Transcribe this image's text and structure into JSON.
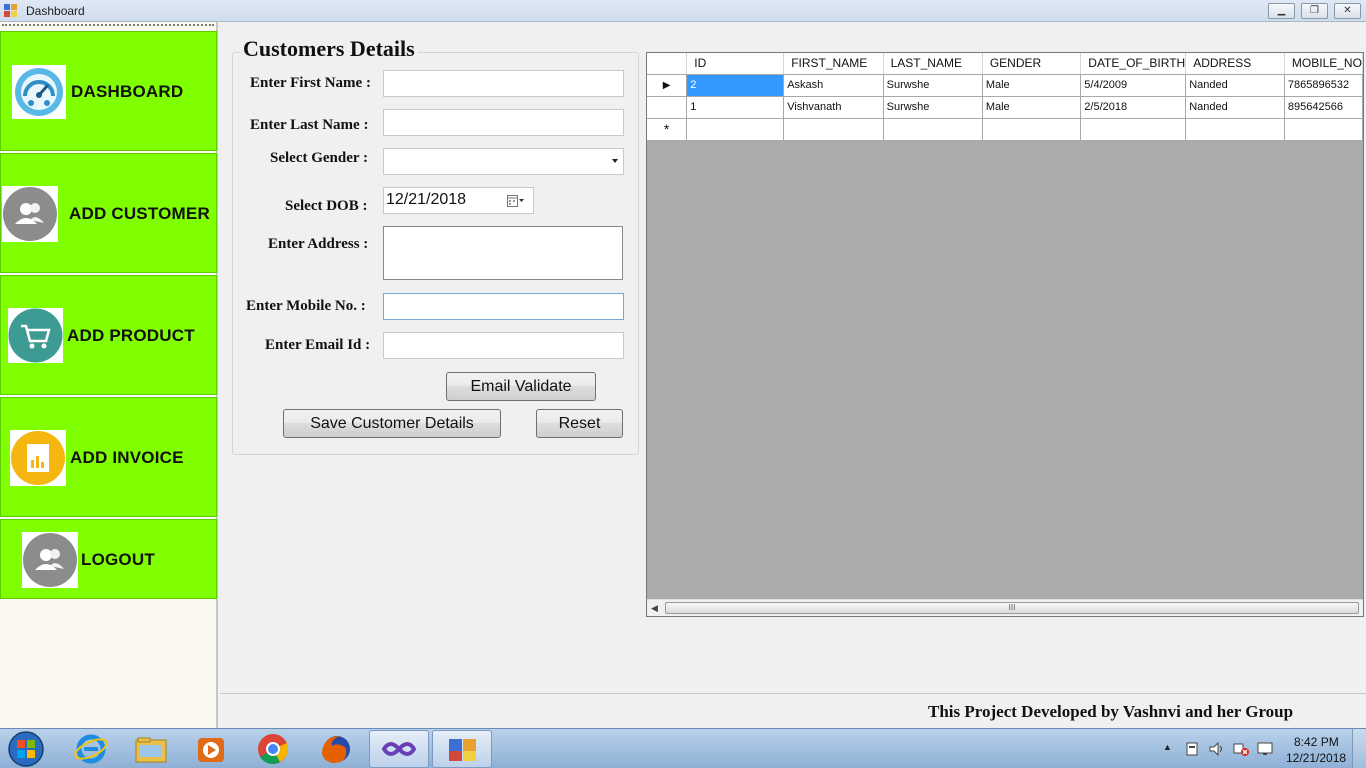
{
  "window": {
    "title": "Dashboard",
    "controls": {
      "minimize": "▁",
      "restore": "❐",
      "close": "✕"
    }
  },
  "sidebar": {
    "items": [
      {
        "label": "DASHBOARD",
        "icon": "speedometer-icon"
      },
      {
        "label": "ADD CUSTOMER",
        "icon": "users-icon"
      },
      {
        "label": "ADD PRODUCT",
        "icon": "cart-icon"
      },
      {
        "label": "ADD INVOICE",
        "icon": "chart-document-icon"
      },
      {
        "label": "LOGOUT",
        "icon": "user-icon"
      }
    ]
  },
  "form": {
    "title": "Customers Details",
    "first_name": {
      "label": "Enter First Name :",
      "value": ""
    },
    "last_name": {
      "label": "Enter Last Name :",
      "value": ""
    },
    "gender": {
      "label": "Select Gender :",
      "value": ""
    },
    "dob": {
      "label": "Select DOB :",
      "value": "12/21/2018"
    },
    "address": {
      "label": "Enter Address :",
      "value": ""
    },
    "mobile": {
      "label": "Enter Mobile No. :",
      "value": ""
    },
    "email": {
      "label": "Enter Email Id :",
      "value": ""
    },
    "email_validate_button": "Email Validate",
    "save_button": "Save Customer Details",
    "reset_button": "Reset"
  },
  "grid": {
    "columns": [
      "ID",
      "FIRST_NAME",
      "LAST_NAME",
      "GENDER",
      "DATE_OF_BIRTH",
      "ADDRESS",
      "MOBILE_NO"
    ],
    "rows": [
      [
        "2",
        "Askash",
        "Surwshe",
        "Male",
        "5/4/2009",
        "Nanded",
        "7865896532"
      ],
      [
        "1",
        "Vishvanath",
        "Surwshe",
        "Male",
        "2/5/2018",
        "Nanded",
        "895642566"
      ]
    ],
    "current_row_marker": "▶",
    "new_row_marker": "*",
    "scroll_grip": "III"
  },
  "footer": {
    "text": "This Project Developed by Vashnvi and her Group"
  },
  "taskbar": {
    "apps": [
      "internet-explorer-icon",
      "file-explorer-icon",
      "media-player-icon",
      "chrome-icon",
      "firefox-icon",
      "visual-studio-icon",
      "windows-forms-app-icon"
    ],
    "clock": {
      "time": "8:42 PM",
      "date": "12/21/2018"
    },
    "tray_expand": "▲"
  },
  "colors": {
    "nav_green": "#80ff00",
    "selection_blue": "#3399ff",
    "grid_background": "#ababab"
  }
}
